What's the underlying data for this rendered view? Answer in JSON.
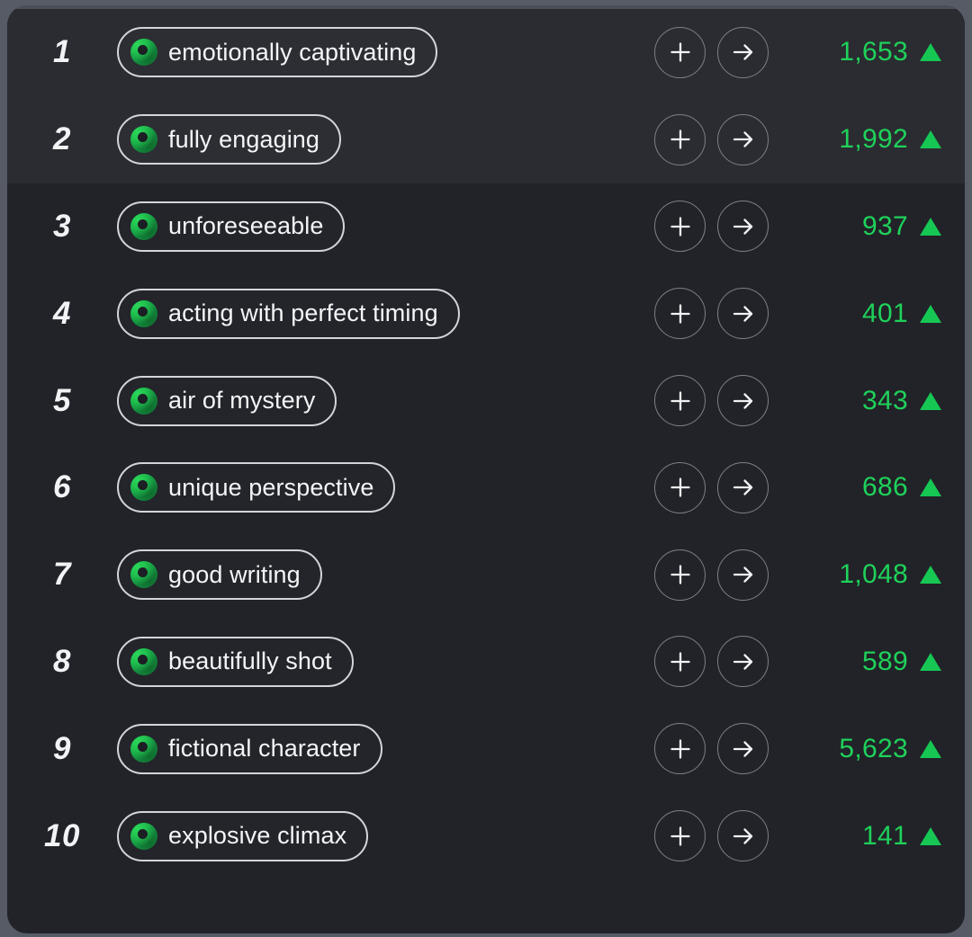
{
  "theme": {
    "page_background": "#565b66",
    "card_background": "#212328",
    "row_stripe_light": "#2a2c31",
    "accent_green": "#1fd15a",
    "trend_green": "#16c754",
    "pill_border": "#d3d5da",
    "button_border": "#7c808a",
    "text_primary": "#f4f5f7"
  },
  "icons": {
    "tag_icon": "green-swirl-icon",
    "add_icon": "plus-icon",
    "open_icon": "arrow-right-icon",
    "trend_icon": "triangle-up-icon"
  },
  "actions": {
    "add_label": "+",
    "open_label": "→"
  },
  "ranking": {
    "rows": [
      {
        "rank": "1",
        "label": "emotionally captivating",
        "score": "1,653",
        "trend": "up"
      },
      {
        "rank": "2",
        "label": "fully engaging",
        "score": "1,992",
        "trend": "up"
      },
      {
        "rank": "3",
        "label": "unforeseeable",
        "score": "937",
        "trend": "up"
      },
      {
        "rank": "4",
        "label": "acting with perfect timing",
        "score": "401",
        "trend": "up"
      },
      {
        "rank": "5",
        "label": "air of mystery",
        "score": "343",
        "trend": "up"
      },
      {
        "rank": "6",
        "label": "unique perspective",
        "score": "686",
        "trend": "up"
      },
      {
        "rank": "7",
        "label": "good writing",
        "score": "1,048",
        "trend": "up"
      },
      {
        "rank": "8",
        "label": "beautifully shot",
        "score": "589",
        "trend": "up"
      },
      {
        "rank": "9",
        "label": "fictional character",
        "score": "5,623",
        "trend": "up"
      },
      {
        "rank": "10",
        "label": "explosive climax",
        "score": "141",
        "trend": "up"
      }
    ]
  }
}
